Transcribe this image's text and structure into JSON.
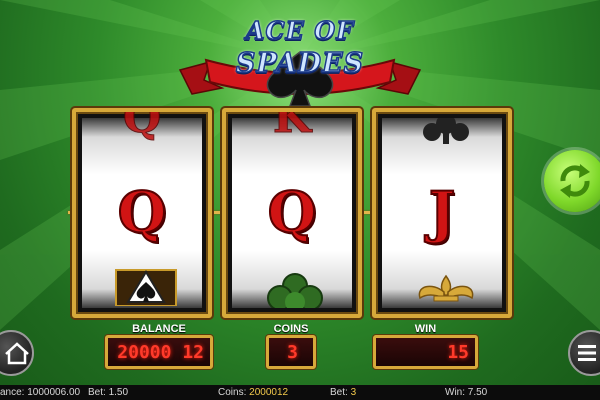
{
  "logo": {
    "line1": "ACE OF",
    "line2": "SPADES"
  },
  "reels": [
    {
      "symbol": "Q",
      "top_partial": "Q",
      "bottom_symbol": "spade-diamond-icon"
    },
    {
      "symbol": "Q",
      "top_partial": "K",
      "bottom_symbol": "clover-icon"
    },
    {
      "symbol": "J",
      "top_partial": "",
      "bottom_symbol": "fleur-icon"
    }
  ],
  "displays": {
    "balance_label": "BALANCE",
    "balance_value": "20000 12",
    "coins_label": "COINS",
    "coins_value": "3",
    "win_label": "WIN",
    "win_value": "15"
  },
  "status": {
    "balance_text": "ance: 1000006.00",
    "bet_text": "Bet: 1.50",
    "coins_label": "Coins:",
    "coins_value": "2000012",
    "bet_label": "Bet:",
    "bet_value": "3",
    "win_text": "Win: 7.50"
  },
  "colors": {
    "background": "#2e8a2a",
    "reel_frame": "#d7a93a",
    "digits": "#ff3a2a",
    "spin": "#7fd82a",
    "ribbon": "#c8141a"
  }
}
